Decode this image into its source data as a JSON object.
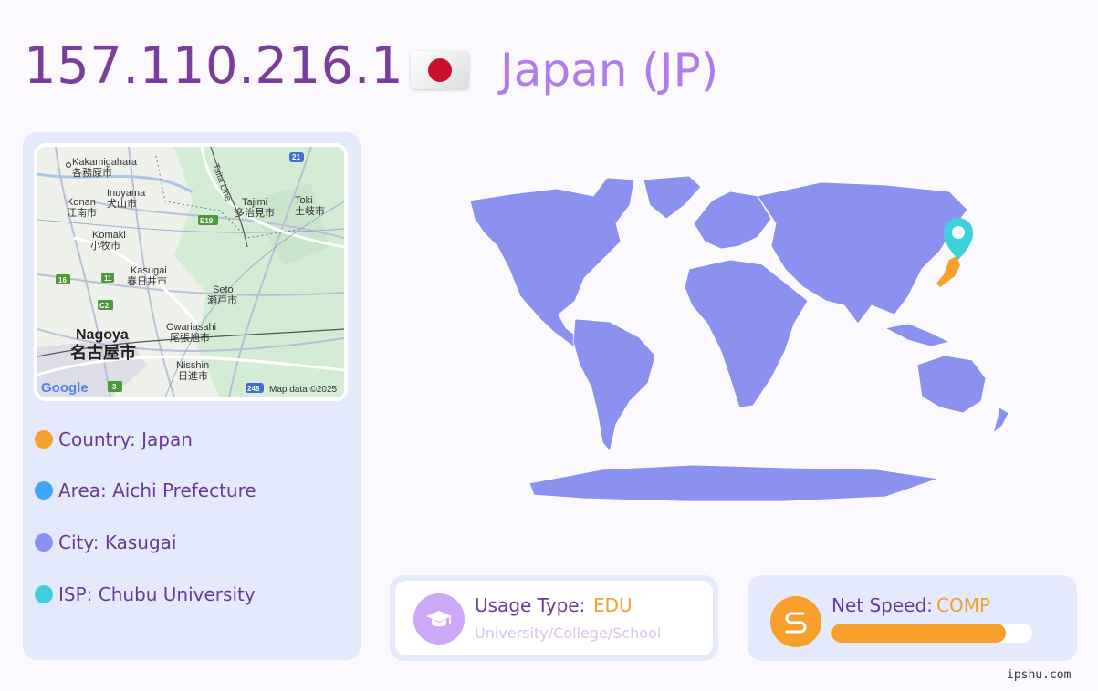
{
  "header": {
    "ip": "157.110.216.1",
    "country_title": "Japan (JP)"
  },
  "map": {
    "places": [
      {
        "en": "Kakamigahara",
        "jp": "各務原市"
      },
      {
        "en": "Inuyama",
        "jp": "犬山市"
      },
      {
        "en": "Konan",
        "jp": "江南市"
      },
      {
        "en": "Tajimi",
        "jp": "多治見市"
      },
      {
        "en": "Toki",
        "jp": "土岐市"
      },
      {
        "en": "Komaki",
        "jp": "小牧市"
      },
      {
        "en": "Kasugai",
        "jp": "春日井市"
      },
      {
        "en": "Seto",
        "jp": "瀬戸市"
      },
      {
        "en": "Owariasahi",
        "jp": "尾張旭市"
      },
      {
        "en": "Nagoya",
        "jp": "名古屋市"
      },
      {
        "en": "Nisshin",
        "jp": "日進市"
      }
    ],
    "rail_line": "Taita Line",
    "road_labels": [
      "21",
      "E19",
      "16",
      "11",
      "C2",
      "3",
      "248"
    ],
    "logo": "Google",
    "attribution": "Map data ©2025"
  },
  "info": [
    {
      "text": "Country: Japan",
      "color": "#f7a02b"
    },
    {
      "text": "Area: Aichi Prefecture",
      "color": "#3ea6f5"
    },
    {
      "text": "City: Kasugai",
      "color": "#8a91ee"
    },
    {
      "text": "ISP: Chubu University",
      "color": "#3fd0dd"
    }
  ],
  "usage": {
    "label": "Usage Type:",
    "value": "EDU",
    "sub": "University/College/School",
    "icon": "graduation-cap-icon"
  },
  "speed": {
    "label": "Net Speed:",
    "value": "COMP",
    "level": 0.87,
    "icon": "speed-route-icon"
  },
  "colors": {
    "accent": "#7b3d9b",
    "country": "#b07ce9",
    "orange": "#f7a02b",
    "continents": "#8a91ee",
    "pin": "#3fd0dd",
    "card": "#e4e9fb"
  },
  "watermark": "ipshu.com"
}
